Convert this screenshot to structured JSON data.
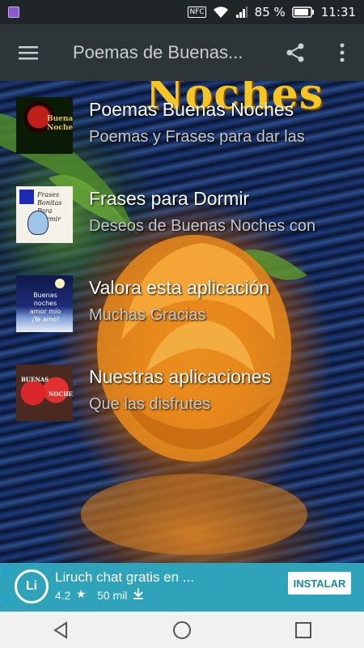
{
  "status_bar": {
    "battery_percent": "85 %",
    "time": "11:31",
    "icons": [
      "gallery-icon",
      "nfc-icon",
      "wifi-icon",
      "signal-icon",
      "battery-icon"
    ],
    "nfc_label": "NFC"
  },
  "app_bar": {
    "title": "Poemas de Buenas...",
    "icons": [
      "menu-icon",
      "share-icon",
      "overflow-menu-icon"
    ]
  },
  "background": {
    "title": "Noches"
  },
  "items": [
    {
      "title": "Poemas Buenas Noches",
      "subtitle": "Poemas y Frases para dar las",
      "thumb_text": "Buenas\nNoches"
    },
    {
      "title": "Frases para Dormir",
      "subtitle": "Deseos de Buenas Noches con",
      "thumb_text": "Frases\nBonitas\nPara\nDormir"
    },
    {
      "title": "Valora esta aplicación",
      "subtitle": "Muchas Gracias",
      "thumb_text": "Buenas noches\namor mío\n¡Te amo!"
    },
    {
      "title": "Nuestras aplicaciones",
      "subtitle": "Que las disfrutes",
      "thumb_text_1": "BUENAS",
      "thumb_text_2": "NOCHES"
    }
  ],
  "ad": {
    "title": "Liruch chat gratis en ...",
    "rating": "4.2",
    "downloads": "50 mil",
    "install_label": "INSTALAR",
    "logo_letter": "Li",
    "colors": {
      "background": "#2ea3b9",
      "button_text": "#1a8aa0"
    }
  },
  "nav_bar": {
    "icons": [
      "back-icon",
      "home-icon",
      "recents-icon"
    ]
  }
}
